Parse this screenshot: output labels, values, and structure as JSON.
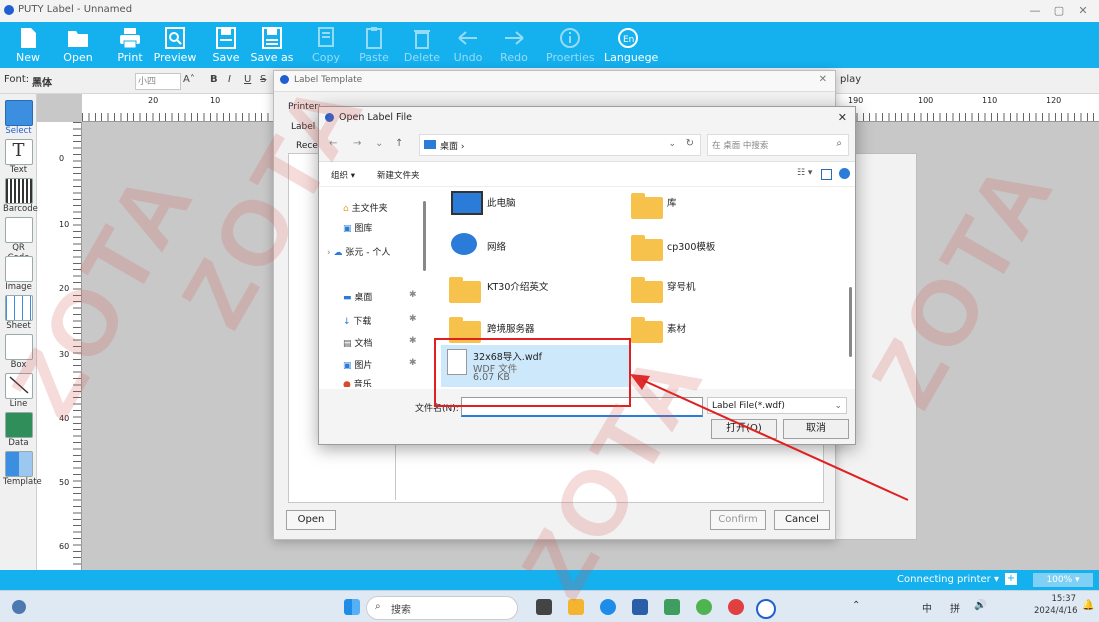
{
  "window": {
    "title": "PUTY Label - Unnamed",
    "minimize": "—",
    "maximize": "▢",
    "close": "✕"
  },
  "toolbar": [
    {
      "label": "New",
      "icon": "new-file-icon"
    },
    {
      "label": "Open",
      "icon": "folder-icon"
    },
    {
      "label": "Print",
      "icon": "printer-icon"
    },
    {
      "label": "Preview",
      "icon": "preview-icon"
    },
    {
      "label": "Save",
      "icon": "save-icon"
    },
    {
      "label": "Save as",
      "icon": "save-as-icon"
    },
    {
      "label": "Copy",
      "icon": "copy-icon"
    },
    {
      "label": "Paste",
      "icon": "paste-icon"
    },
    {
      "label": "Delete",
      "icon": "trash-icon"
    },
    {
      "label": "Undo",
      "icon": "undo-arrow-icon"
    },
    {
      "label": "Redo",
      "icon": "redo-arrow-icon"
    },
    {
      "label": "Proerties",
      "icon": "info-icon"
    },
    {
      "label": "Languege",
      "icon": "language-icon"
    }
  ],
  "fontbar": {
    "font_label": "Font:",
    "font_value": "黑体",
    "size_value": "小四",
    "bold": "B",
    "italic": "I",
    "underline": "U",
    "strike": "S",
    "resize": "A˄",
    "display": "play"
  },
  "tools": [
    {
      "label": "Select"
    },
    {
      "label": "Text"
    },
    {
      "label": "Barcode"
    },
    {
      "label": "QR Code"
    },
    {
      "label": "Image"
    },
    {
      "label": "Sheet"
    },
    {
      "label": "Box"
    },
    {
      "label": "Line"
    },
    {
      "label": "Data"
    },
    {
      "label": "Template"
    }
  ],
  "ruler": {
    "top": [
      "20",
      "10",
      "190",
      "100",
      "110",
      "120"
    ],
    "left": [
      "0",
      "10",
      "20",
      "30",
      "40",
      "50",
      "60"
    ]
  },
  "template_dialog": {
    "title": "Label Template",
    "printer_label": "Printer:",
    "label_label": "Label",
    "recent_label": "Rece",
    "open_button": "Open",
    "confirm_button": "Confirm",
    "cancel_button": "Cancel"
  },
  "open_dialog": {
    "title": "Open Label File",
    "path": "桌面  ›",
    "search_placeholder": "在 桌面 中搜索",
    "organize": "组织 ▾",
    "new_folder": "新建文件夹",
    "sidebar": [
      {
        "label": "主文件夹"
      },
      {
        "label": "图库"
      },
      {
        "label": "张元 - 个人"
      },
      {
        "label": "桌面"
      },
      {
        "label": "下载"
      },
      {
        "label": "文档"
      },
      {
        "label": "图片"
      },
      {
        "label": "音乐"
      }
    ],
    "items": [
      {
        "name": "此电脑",
        "kind": "computer"
      },
      {
        "name": "库",
        "kind": "folder"
      },
      {
        "name": "网络",
        "kind": "network"
      },
      {
        "name": "cp300模板",
        "kind": "folder"
      },
      {
        "name": "KT30介绍英文",
        "kind": "folder"
      },
      {
        "name": "穿号机",
        "kind": "folder"
      },
      {
        "name": "跨境服务器",
        "kind": "folder"
      },
      {
        "name": "素材",
        "kind": "folder"
      }
    ],
    "selected_file": {
      "name": "32x68导入.wdf",
      "type": "WDF 文件",
      "size": "6.07 KB"
    },
    "filename_label": "文件名(N):",
    "filename_value": "",
    "filter": "Label File(*.wdf)",
    "open_button": "打开(O)",
    "cancel_button": "取消"
  },
  "status": {
    "printer": "Connecting printer ▾",
    "zoom": "100% ▾"
  },
  "taskbar": {
    "search": "搜索",
    "ime1": "中",
    "ime2": "拼",
    "time": "15:37",
    "date": "2024/4/16"
  },
  "watermark": {
    "text": "ZOTA"
  },
  "colors": {
    "toolbar": "#15b0ee",
    "highlight": "#e02020",
    "selection": "#cde8fb"
  }
}
